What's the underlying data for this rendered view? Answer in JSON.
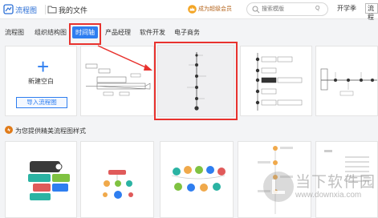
{
  "topbar": {
    "app_title": "流程图",
    "breadcrumb": "我的文件",
    "vip_label": "成为超级会员",
    "search_placeholder": "搜索模版",
    "search_scope": "Q",
    "kxj_label": "开学季",
    "flow_label": "流程"
  },
  "tabs": {
    "items": [
      "流程图",
      "组织结构图",
      "时间轴",
      "产品经理",
      "软件开发",
      "电子商务"
    ],
    "active": "时间轴"
  },
  "new_card": {
    "label": "新建空白",
    "import_label": "导入流程图"
  },
  "section": {
    "title": "为您提供精美流程图样式"
  },
  "watermark": {
    "text": "当下软件园",
    "url": "www.downxia.com"
  },
  "colors": {
    "accent": "#2e7ef0",
    "highlight": "#e8322e"
  }
}
